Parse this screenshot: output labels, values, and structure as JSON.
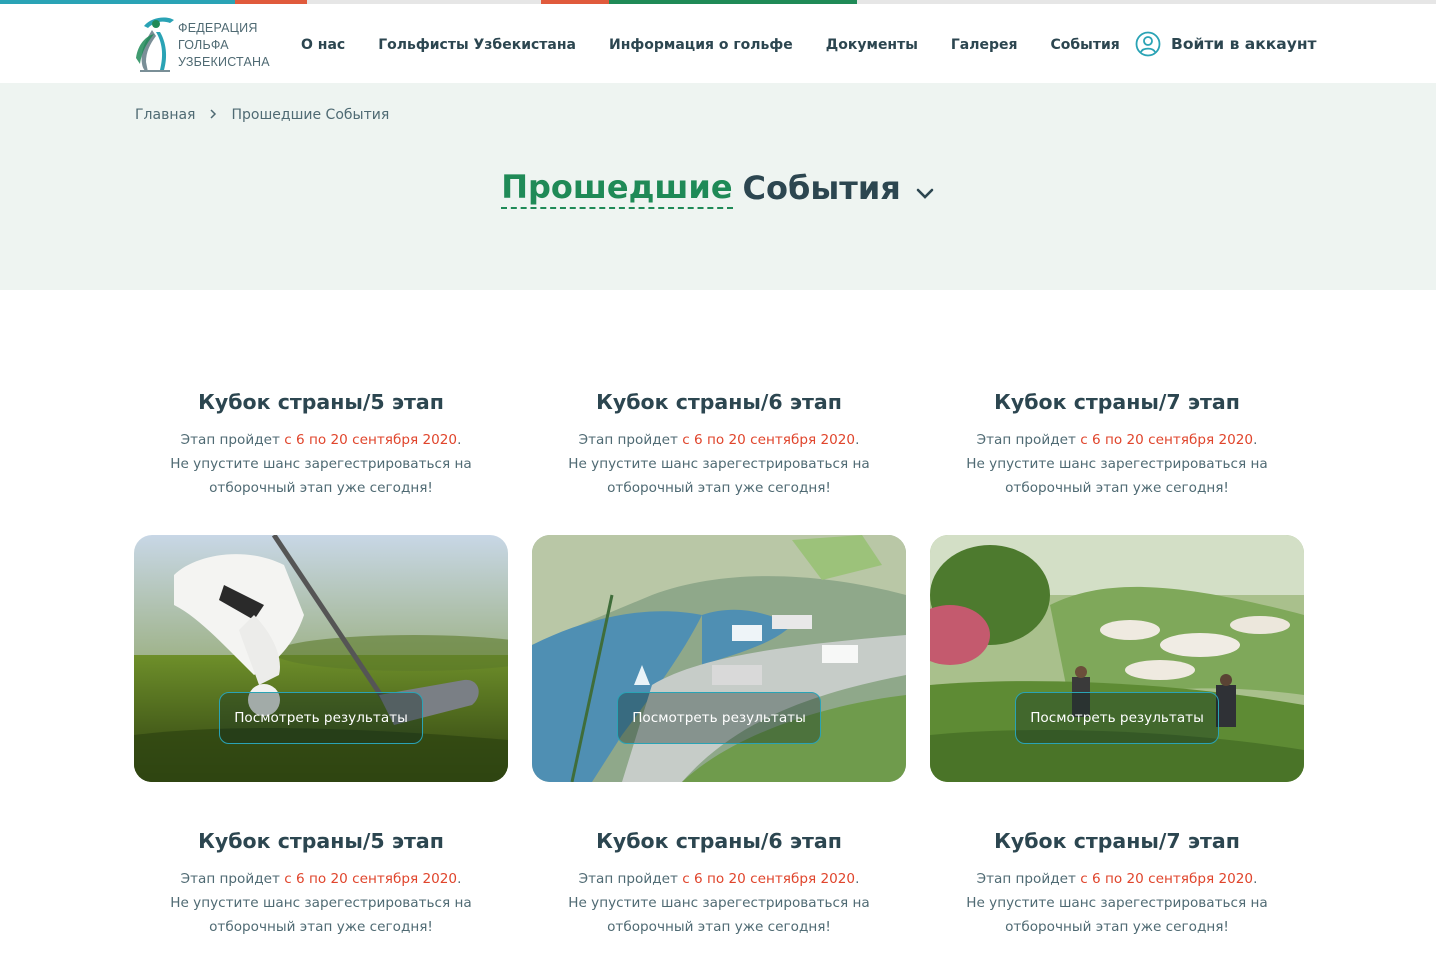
{
  "header": {
    "logo_lines": [
      "ФЕДЕРАЦИЯ",
      "ГОЛЬФА",
      "УЗБЕКИСТАНА"
    ],
    "nav": [
      "О нас",
      "Гольфисты Узбекистана",
      "Информация о гольфе",
      "Документы",
      "Галерея",
      "События"
    ],
    "login_label": "Войти в аккаунт"
  },
  "breadcrumb": {
    "home": "Главная",
    "current": "Прошедшие События"
  },
  "page_heading": {
    "highlight": "Прошедшие",
    "rest": "События"
  },
  "cards": [
    {
      "title": "Кубок страны/5 этап",
      "text_before": "Этап пройдет ",
      "date": "с 6 по 20 сентября 2020",
      "text_after": ".",
      "line2": "Не упустите шанс зарегестрироваться на",
      "line3": "отборочный этап уже сегодня!",
      "button": "Посмотреть результаты",
      "image": "golf-glove-tee"
    },
    {
      "title": "Кубок страны/6 этап",
      "text_before": "Этап пройдет ",
      "date": "с 6 по 20 сентября 2020",
      "text_after": ".",
      "line2": "Не упустите шанс зарегестрироваться на",
      "line3": "отборочный этап уже сегодня!",
      "button": "Посмотреть результаты",
      "image": "golf-resort-aerial"
    },
    {
      "title": "Кубок страны/7 этап",
      "text_before": "Этап пройдет ",
      "date": "с 6 по 20 сентября 2020",
      "text_after": ".",
      "line2": "Не упустите шанс зарегестрироваться на",
      "line3": "отборочный этап уже сегодня!",
      "button": "Посмотреть результаты",
      "image": "golf-course-bunkers"
    },
    {
      "title": "Кубок страны/5 этап",
      "text_before": "Этап пройдет ",
      "date": "с 6 по 20 сентября 2020",
      "text_after": ".",
      "line2": "Не упустите шанс зарегестрироваться на",
      "line3": "отборочный этап уже сегодня!"
    },
    {
      "title": "Кубок страны/6 этап",
      "text_before": "Этап пройдет ",
      "date": "с 6 по 20 сентября 2020",
      "text_after": ".",
      "line2": "Не упустите шанс зарегестрироваться на",
      "line3": "отборочный этап уже сегодня!"
    },
    {
      "title": "Кубок страны/7 этап",
      "text_before": "Этап пройдет ",
      "date": "с 6 по 20 сентября 2020",
      "text_after": ".",
      "line2": "Не упустите шанс зарегестрироваться на",
      "line3": "отборочный этап уже сегодня!"
    }
  ],
  "colors": {
    "brand_green": "#1f8a57",
    "brand_teal": "#2aa3b5",
    "accent_red": "#e0452c",
    "text_dark": "#2c4650",
    "hero_bg": "#eef4f1"
  }
}
